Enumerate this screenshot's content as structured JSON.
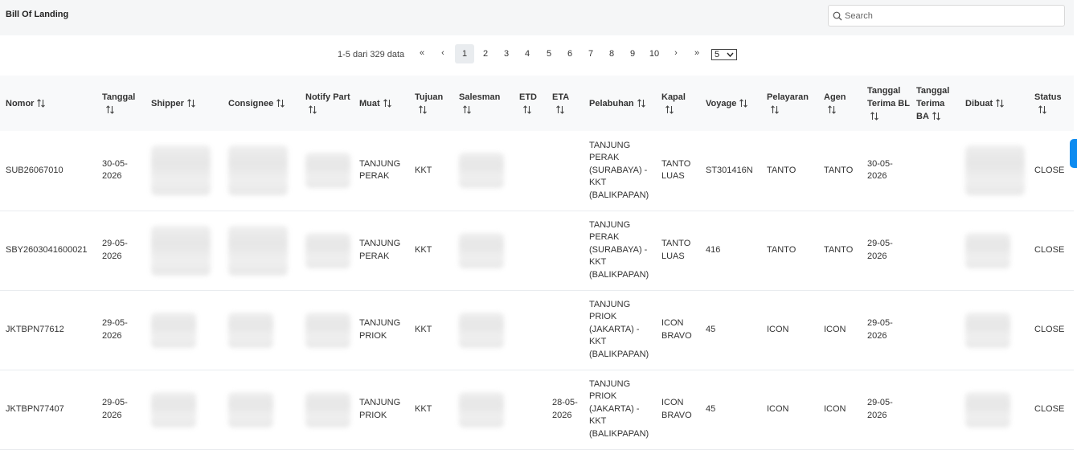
{
  "header": {
    "title": "Bill Of Landing",
    "search_placeholder": "Search",
    "search_value": ""
  },
  "pagination": {
    "info": "1-5 dari 329 data",
    "pages": [
      "1",
      "2",
      "3",
      "4",
      "5",
      "6",
      "7",
      "8",
      "9",
      "10"
    ],
    "active_page": "1",
    "page_size": "5"
  },
  "table": {
    "columns": [
      "Nomor",
      "Tanggal",
      "Shipper",
      "Consignee",
      "Notify Part",
      "Muat",
      "Tujuan",
      "Salesman",
      "ETD",
      "ETA",
      "Pelabuhan",
      "Kapal",
      "Voyage",
      "Pelayaran",
      "Agen",
      "Tanggal Terima BL",
      "Tanggal Terima BA",
      "Dibuat",
      "Status"
    ],
    "rows": [
      {
        "nomor": "SUB26067010",
        "tanggal": "30-05-2026",
        "muat": "TANJUNG PERAK",
        "tujuan": "KKT",
        "etd": "",
        "eta": "",
        "pelabuhan": "TANJUNG PERAK (SURABAYA) - KKT (BALIKPAPAN)",
        "kapal": "TANTO LUAS",
        "voyage": "ST301416N",
        "pelayaran": "TANTO",
        "agen": "TANTO",
        "terima_bl": "30-05-2026",
        "terima_ba": "",
        "status": "CLOSE"
      },
      {
        "nomor": "SBY2603041600021",
        "tanggal": "29-05-2026",
        "muat": "TANJUNG PERAK",
        "tujuan": "KKT",
        "etd": "",
        "eta": "",
        "pelabuhan": "TANJUNG PERAK (SURABAYA) - KKT (BALIKPAPAN)",
        "kapal": "TANTO LUAS",
        "voyage": "416",
        "pelayaran": "TANTO",
        "agen": "TANTO",
        "terima_bl": "29-05-2026",
        "terima_ba": "",
        "status": "CLOSE"
      },
      {
        "nomor": "JKTBPN77612",
        "tanggal": "29-05-2026",
        "muat": "TANJUNG PRIOK",
        "tujuan": "KKT",
        "etd": "",
        "eta": "",
        "pelabuhan": "TANJUNG PRIOK (JAKARTA) - KKT (BALIKPAPAN)",
        "kapal": "ICON BRAVO",
        "voyage": "45",
        "pelayaran": "ICON",
        "agen": "ICON",
        "terima_bl": "29-05-2026",
        "terima_ba": "",
        "status": "CLOSE"
      },
      {
        "nomor": "JKTBPN77407",
        "tanggal": "29-05-2026",
        "muat": "TANJUNG PRIOK",
        "tujuan": "KKT",
        "etd": "",
        "eta": "28-05-2026",
        "pelabuhan": "TANJUNG PRIOK (JAKARTA) - KKT (BALIKPAPAN)",
        "kapal": "ICON BRAVO",
        "voyage": "45",
        "pelayaran": "ICON",
        "agen": "ICON",
        "terima_bl": "29-05-2026",
        "terima_ba": "",
        "status": "CLOSE"
      }
    ]
  }
}
